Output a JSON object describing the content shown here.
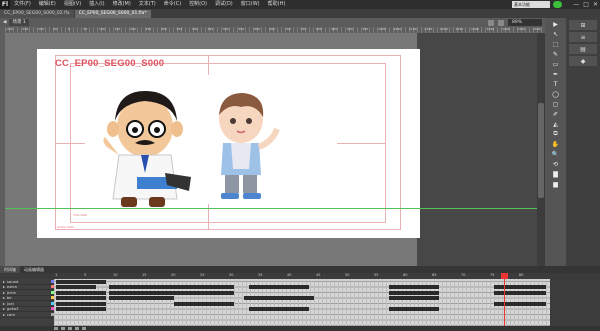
{
  "app": {
    "logo": "Fl"
  },
  "menu": [
    "文件(F)",
    "编辑(E)",
    "视图(V)",
    "插入(I)",
    "修改(M)",
    "文本(T)",
    "命令(C)",
    "控制(O)",
    "调试(D)",
    "窗口(W)",
    "帮助(H)"
  ],
  "workspace_label": "基本功能",
  "window_buttons": [
    "—",
    "□",
    "✕"
  ],
  "tabs": [
    {
      "label": "CC_EP00_SEG00_S000_02.fla"
    },
    {
      "label": "CC_EP00_SEG00_S000_01.fla*"
    }
  ],
  "editbar": {
    "scene": "场景 1",
    "zoom": "89%"
  },
  "ruler_labels": [
    "-200",
    "-150",
    "-100",
    "-50",
    "0",
    "50",
    "100",
    "150",
    "200",
    "250",
    "300",
    "350",
    "400",
    "450",
    "500",
    "550",
    "600",
    "650",
    "700",
    "750",
    "800",
    "850",
    "900",
    "950",
    "1000",
    "1050",
    "1100",
    "1150",
    "1200",
    "1250",
    "1300",
    "1350",
    "1400",
    "1450",
    "1500",
    "1550"
  ],
  "stage": {
    "title": "CC_EP00_SEG00_S000",
    "safe_label": "Title Safe",
    "action_label": "Action Safe"
  },
  "timeline": {
    "tabs": [
      "时间轴",
      "动画编辑器"
    ],
    "frame_numbers": [
      "1",
      "5",
      "10",
      "15",
      "20",
      "25",
      "30",
      "35",
      "40",
      "45",
      "50",
      "55",
      "60",
      "65",
      "70",
      "75",
      "80"
    ],
    "layers": [
      {
        "name": "sound",
        "color": "#7a7aff"
      },
      {
        "name": "extra",
        "color": "#ff7a7a"
      },
      {
        "name": "jiche",
        "color": "#7aff7a"
      },
      {
        "name": "bir",
        "color": "#ffcc55"
      },
      {
        "name": "juej",
        "color": "#55ccff"
      },
      {
        "name": "geka3",
        "color": "#ff55cc"
      },
      {
        "name": "cam",
        "color": "#aaaaaa"
      }
    ]
  },
  "tools": [
    "▶",
    "↖",
    "⬚",
    "✎",
    "▭",
    "✒",
    "T",
    "◯",
    "▢",
    "✐",
    "◭",
    "⧉",
    "✋",
    "🔍",
    "⟲",
    "▇",
    "▆"
  ],
  "props": [
    "⊞",
    "≡",
    "▤",
    "◆"
  ]
}
